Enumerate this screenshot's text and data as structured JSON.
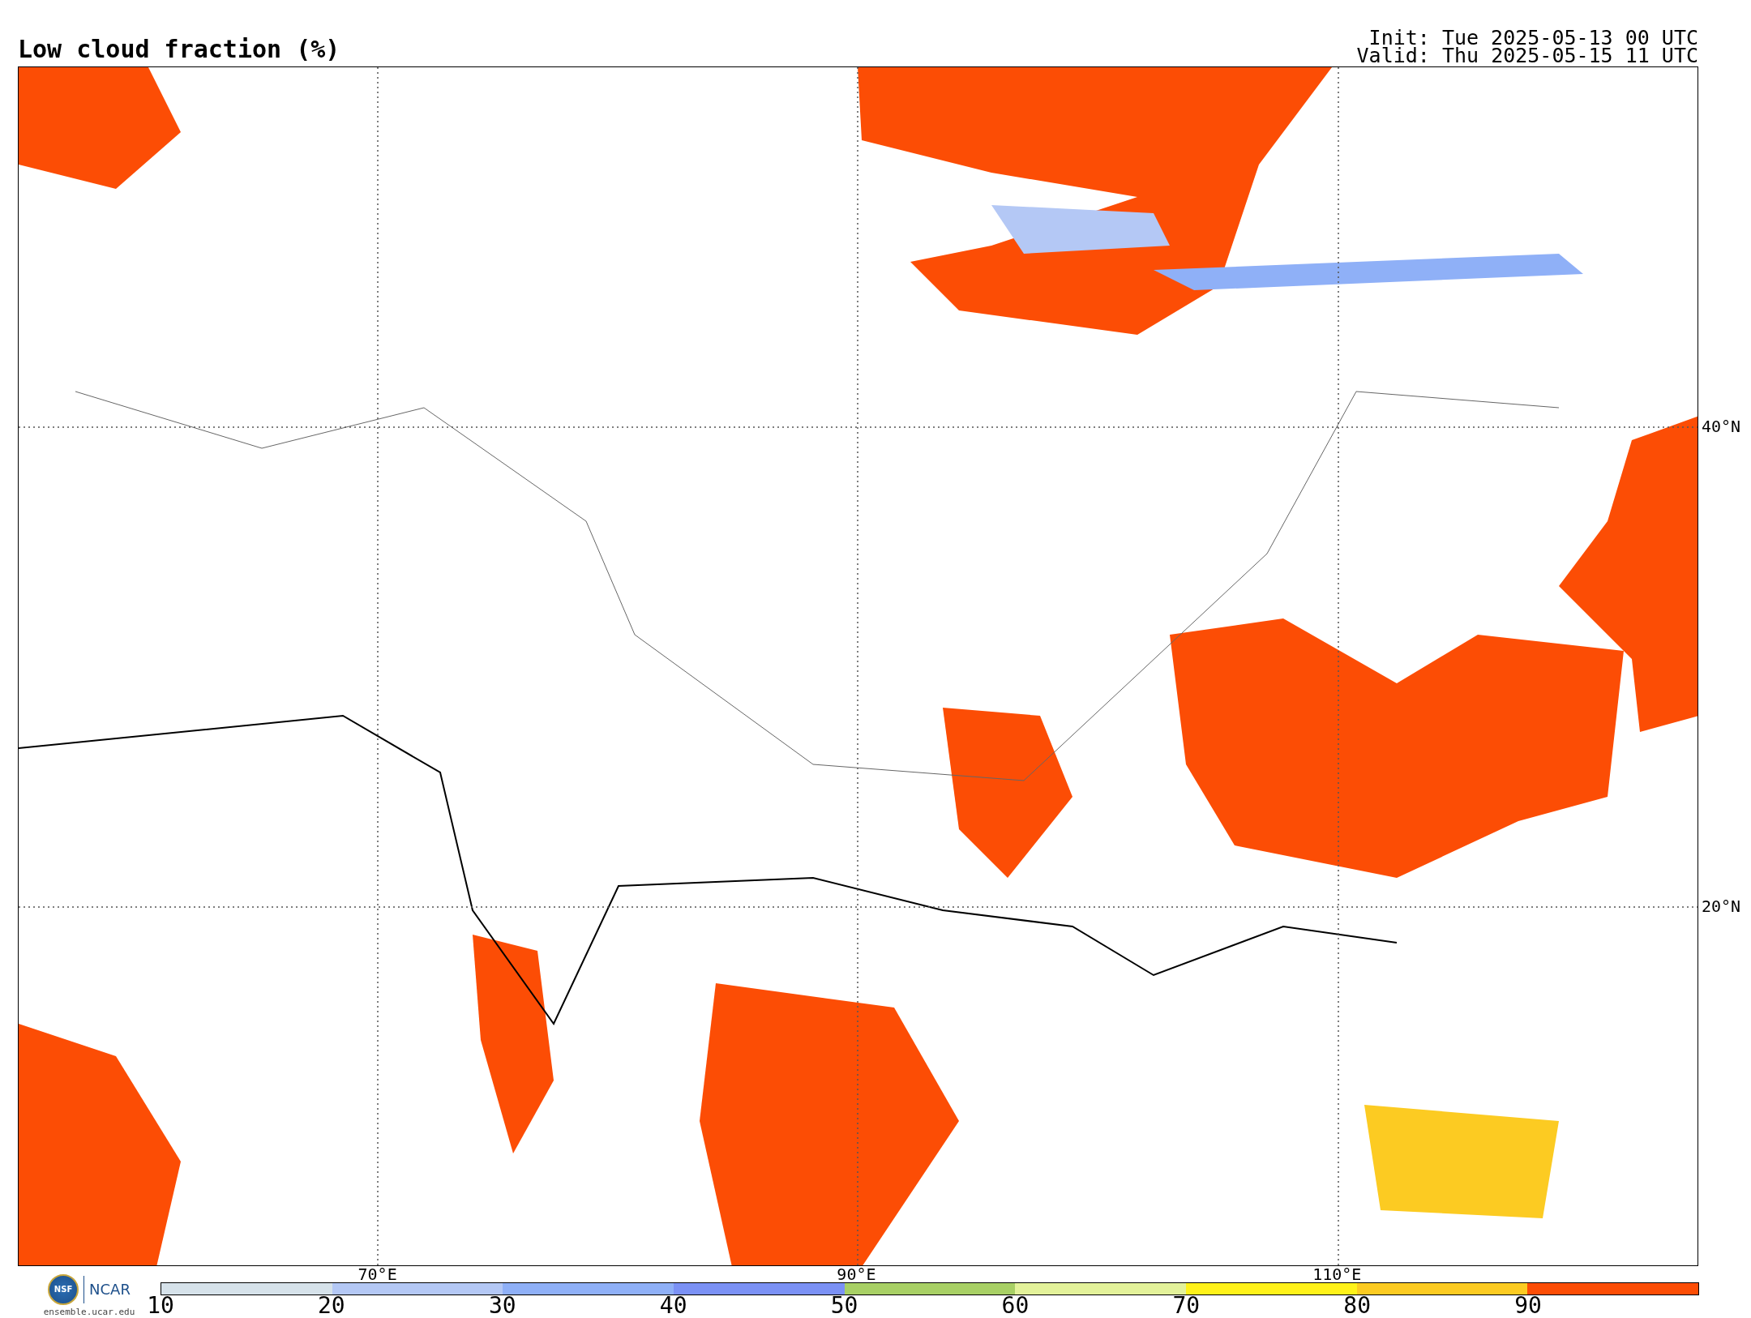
{
  "title": "Low cloud fraction (%)",
  "init": "Init: Tue 2025-05-13 00 UTC",
  "valid": "Valid: Thu 2025-05-15 11 UTC",
  "map": {
    "lat_labels": [
      "40°N",
      "20°N"
    ],
    "lon_labels": [
      "70°E",
      "90°E",
      "110°E"
    ]
  },
  "logo": {
    "nsf": "NSF",
    "ncar": "NCAR",
    "url": "ensemble.ucar.edu"
  },
  "colorbar": {
    "bins": [
      {
        "color": "#d6e2ea"
      },
      {
        "color": "#b4c8f5"
      },
      {
        "color": "#8fb0f7"
      },
      {
        "color": "#7b91f5"
      },
      {
        "color": "#a8d065"
      },
      {
        "color": "#e3f29a"
      },
      {
        "color": "#fff21a"
      },
      {
        "color": "#fccb22"
      },
      {
        "color": "#fc4d05"
      }
    ],
    "ticks": [
      "10",
      "20",
      "30",
      "40",
      "50",
      "60",
      "70",
      "80",
      "90"
    ]
  }
}
